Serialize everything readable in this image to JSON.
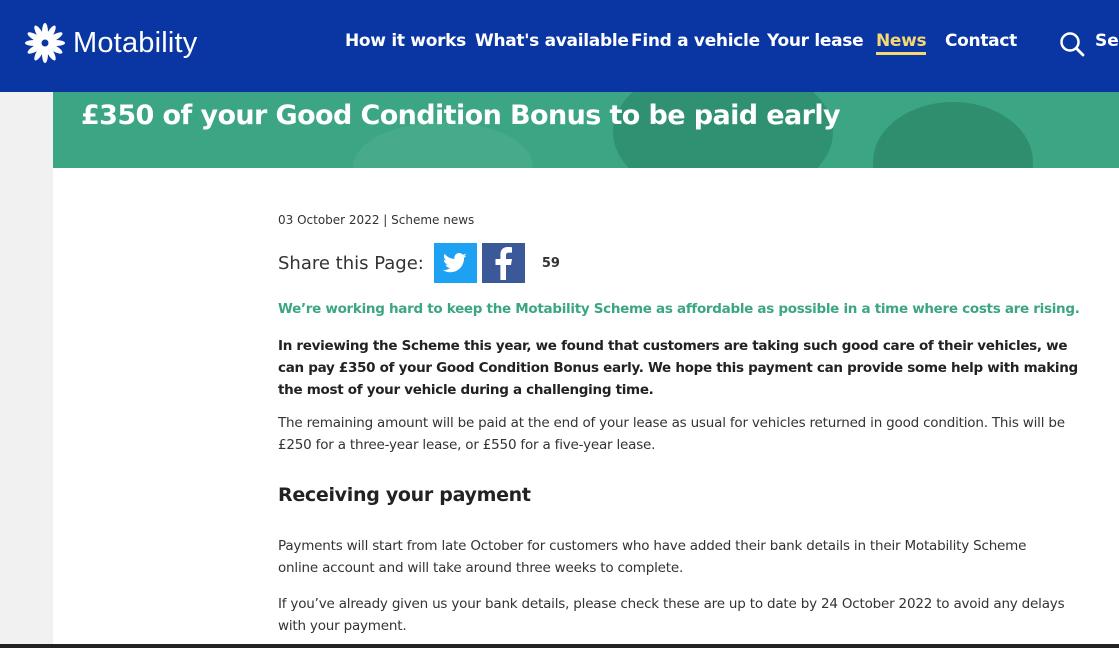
{
  "header": {
    "logo_text": "Motability",
    "nav": [
      {
        "label": "How it works"
      },
      {
        "label": "What's available"
      },
      {
        "label": "Find a vehicle"
      },
      {
        "label": "Your lease"
      },
      {
        "label": "News",
        "active": true
      },
      {
        "label": "Contact"
      }
    ],
    "search_label": "Sea"
  },
  "hero": {
    "title": "£350 of your Good Condition Bonus to be paid early"
  },
  "article": {
    "meta": "03 October 2022 | Scheme news",
    "share_label": "Share this Page:",
    "share_count": "59",
    "lead": "We’re working hard to keep the Motability Scheme as affordable as possible in a time where costs are rising.",
    "bold_para": "In reviewing the Scheme this year, we found that customers are taking such good care of their vehicles, we can pay £350 of your Good Condition Bonus early. We hope this payment can provide some help with making the most of your vehicle during a challenging time.",
    "para1": "The remaining amount will be paid at the end of your lease as usual for vehicles returned in good condition. This will be £250 for a three-year lease, or £550 for a five-year lease.",
    "heading": "Receiving your payment",
    "para2": "Payments will start from late October for customers who have added their bank details in their Motability Scheme online account and will take around three weeks to complete.",
    "para3": "If you’ve already given us your bank details, please check these are up to date by 24 October 2022 to avoid any delays with your payment."
  },
  "colors": {
    "header_bg": "#0a36a3",
    "accent_green": "#3ba584",
    "nav_active": "#f6d873",
    "twitter": "#1da1f2",
    "facebook": "#3b5998"
  }
}
